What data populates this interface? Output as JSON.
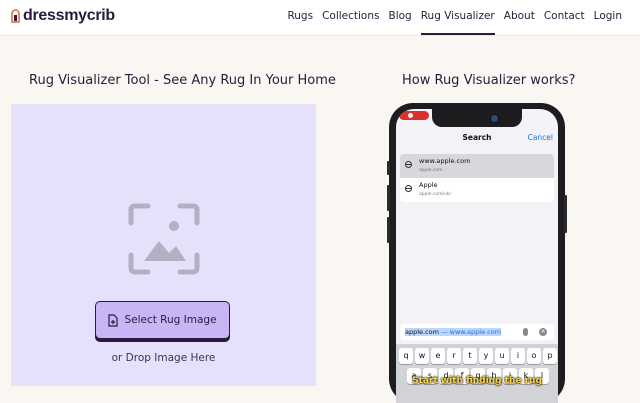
{
  "header": {
    "logo_text": "dressmycrib",
    "nav": [
      {
        "label": "Rugs",
        "active": false
      },
      {
        "label": "Collections",
        "active": false
      },
      {
        "label": "Blog",
        "active": false
      },
      {
        "label": "Rug Visualizer",
        "active": true
      },
      {
        "label": "About",
        "active": false
      },
      {
        "label": "Contact",
        "active": false
      },
      {
        "label": "Login",
        "active": false
      }
    ]
  },
  "tool": {
    "title": "Rug Visualizer Tool - See Any Rug In Your Home",
    "select_button_label": "Select Rug Image",
    "drop_text": "or Drop Image Here",
    "upload_icon": "image-placeholder-icon"
  },
  "how": {
    "title": "How Rug Visualizer works?",
    "phone": {
      "search_title": "Search",
      "cancel_label": "Cancel",
      "results": [
        {
          "title": "www.apple.com",
          "url": "apple.com"
        },
        {
          "title": "Apple",
          "url": "apple.com/uk/"
        }
      ],
      "url_text": "apple.com",
      "url_hint": " — www.apple.com",
      "keyboard_row1": [
        "q",
        "w",
        "e",
        "r",
        "t",
        "y",
        "u",
        "i",
        "o",
        "p"
      ],
      "keyboard_row2": [
        "a",
        "s",
        "d",
        "f",
        "g",
        "h",
        "j",
        "k",
        "l"
      ],
      "caption": "Start with finding the rug"
    }
  },
  "colors": {
    "brand_dark": "#2a1b3d",
    "accent_purple": "#c9b4f5",
    "upload_bg": "#e6e1fb",
    "page_bg": "#faf6f2"
  }
}
